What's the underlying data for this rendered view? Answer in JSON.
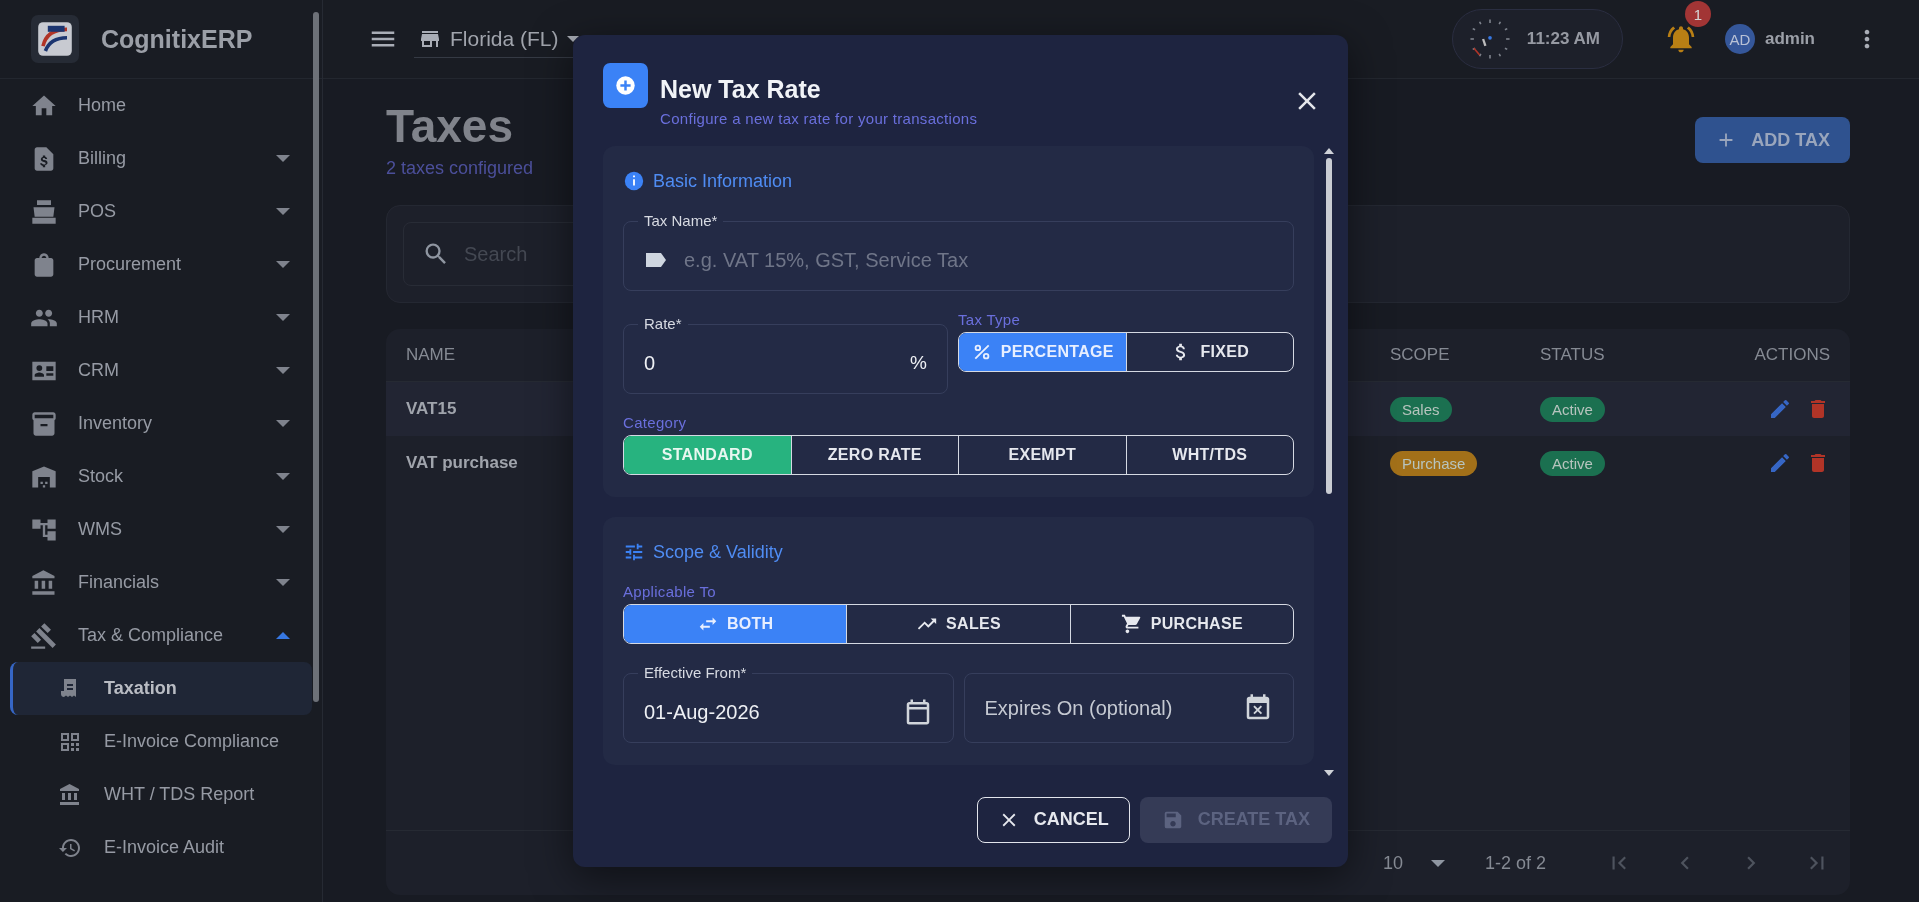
{
  "app": {
    "name": "CognitixERP"
  },
  "sidebar": {
    "items": [
      {
        "label": "Home"
      },
      {
        "label": "Billing",
        "expanded": false
      },
      {
        "label": "POS",
        "expanded": false
      },
      {
        "label": "Procurement",
        "expanded": false
      },
      {
        "label": "HRM",
        "expanded": false
      },
      {
        "label": "CRM",
        "expanded": false
      },
      {
        "label": "Inventory",
        "expanded": false
      },
      {
        "label": "Stock",
        "expanded": false
      },
      {
        "label": "WMS",
        "expanded": false
      },
      {
        "label": "Financials",
        "expanded": false
      },
      {
        "label": "Tax & Compliance",
        "expanded": true,
        "children": [
          {
            "label": "Taxation",
            "selected": true
          },
          {
            "label": "E-Invoice Compliance",
            "selected": false
          },
          {
            "label": "WHT / TDS Report",
            "selected": false
          },
          {
            "label": "E-Invoice Audit",
            "selected": false
          }
        ]
      }
    ]
  },
  "topbar": {
    "store": "Florida (FL)",
    "time": "11:23 AM",
    "notifications": "1",
    "avatar": "AD",
    "user": "admin"
  },
  "page": {
    "title": "Taxes",
    "subtitle": "2 taxes configured",
    "add_button": "ADD TAX",
    "search_placeholder": "Search"
  },
  "table": {
    "columns": [
      "NAME",
      "SCOPE",
      "STATUS",
      "ACTIONS"
    ],
    "rows": [
      {
        "name": "VAT15",
        "scope": {
          "text": "Sales",
          "color": "#1e7a57"
        },
        "status": {
          "text": "Active",
          "color": "#1e7a57"
        }
      },
      {
        "name": "VAT purchase",
        "scope": {
          "text": "Purchase",
          "color": "#b07a1c"
        },
        "status": {
          "text": "Active",
          "color": "#1e7a57"
        }
      }
    ],
    "rows_per_page": "10",
    "range": "1-2 of 2"
  },
  "modal": {
    "title": "New Tax Rate",
    "subtitle": "Configure a new tax rate for your transactions",
    "basic": {
      "heading": "Basic Information",
      "tax_name": {
        "label": "Tax Name*",
        "placeholder": "e.g. VAT 15%, GST, Service Tax"
      },
      "rate": {
        "label": "Rate*",
        "value": "0",
        "suffix": "%"
      },
      "tax_type": {
        "label": "Tax Type",
        "options": [
          {
            "label": "PERCENTAGE",
            "selected": true
          },
          {
            "label": "FIXED",
            "selected": false
          }
        ]
      },
      "category": {
        "label": "Category",
        "options": [
          {
            "label": "STANDARD",
            "selected": true
          },
          {
            "label": "ZERO RATE",
            "selected": false
          },
          {
            "label": "EXEMPT",
            "selected": false
          },
          {
            "label": "WHT/TDS",
            "selected": false
          }
        ]
      }
    },
    "scope": {
      "heading": "Scope & Validity",
      "applicable": {
        "label": "Applicable To",
        "options": [
          {
            "label": "BOTH",
            "selected": true
          },
          {
            "label": "SALES",
            "selected": false
          },
          {
            "label": "PURCHASE",
            "selected": false
          }
        ]
      },
      "effective_from": {
        "label": "Effective From*",
        "value": "01-Aug-2026"
      },
      "expires_on": {
        "placeholder": "Expires On (optional)"
      }
    },
    "cancel": "CANCEL",
    "create": {
      "label": "CREATE TAX",
      "disabled": true
    }
  }
}
